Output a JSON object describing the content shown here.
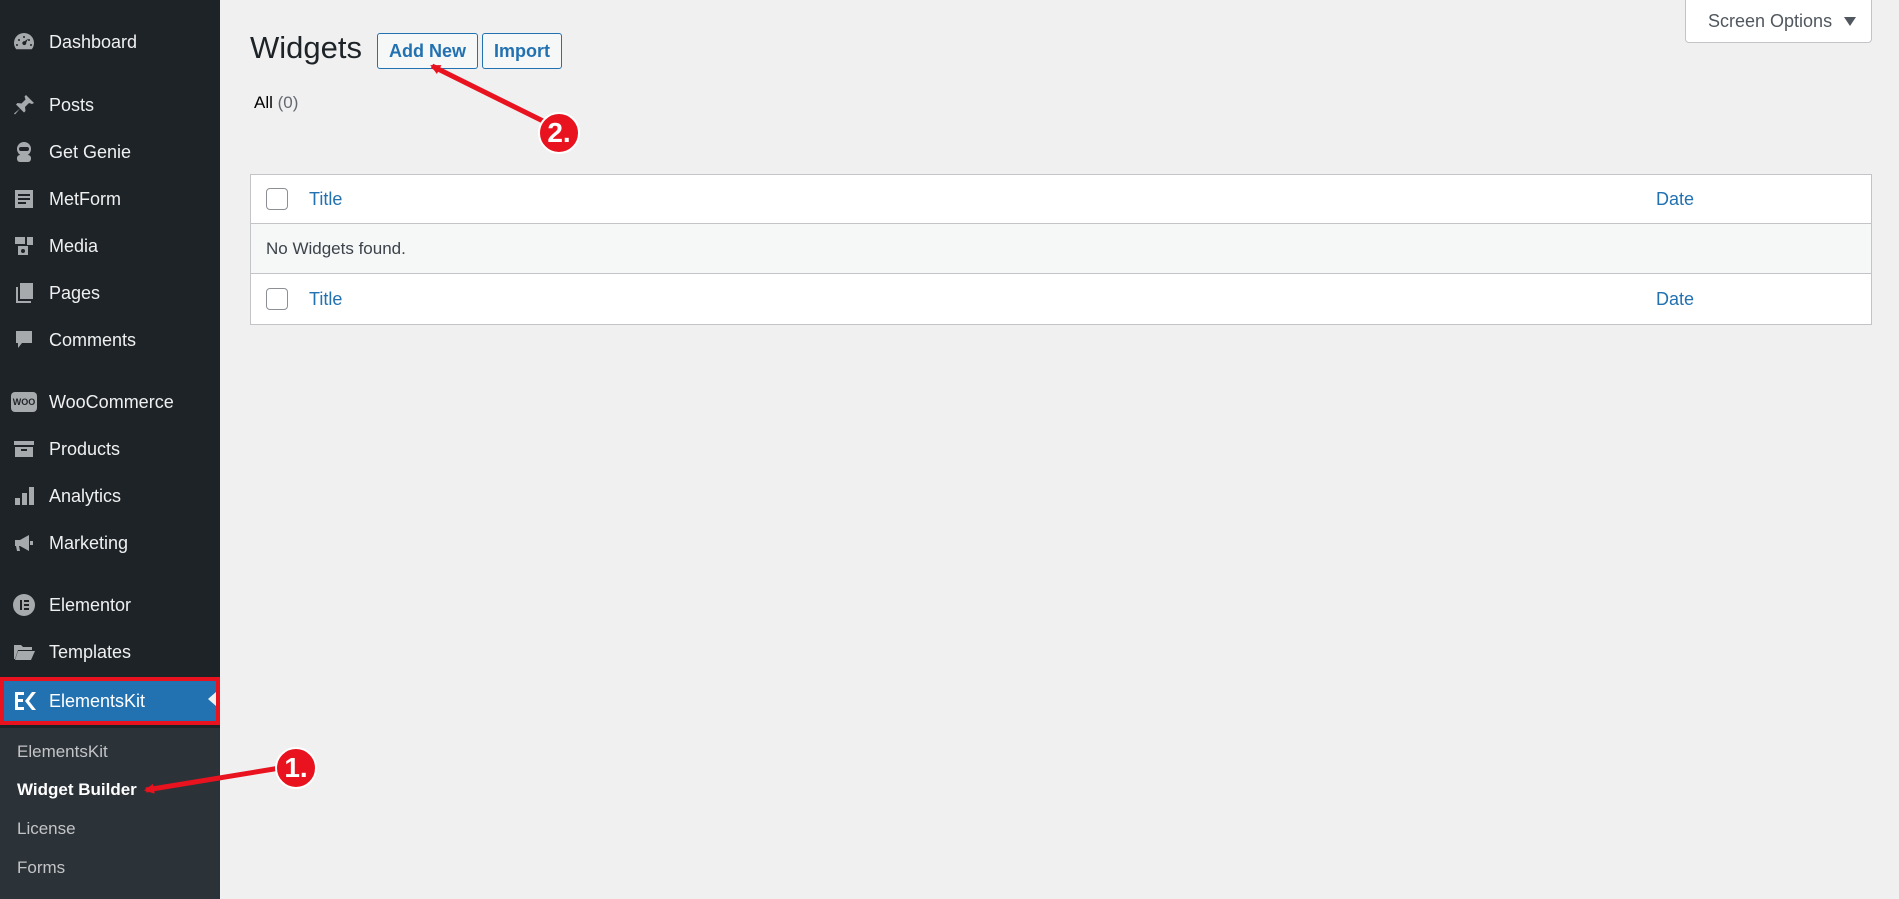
{
  "sidebar": {
    "items": [
      {
        "label": "Dashboard",
        "icon": "dashboard-icon"
      },
      {
        "label": "Posts",
        "icon": "pin-icon"
      },
      {
        "label": "Get Genie",
        "icon": "genie-icon"
      },
      {
        "label": "MetForm",
        "icon": "metform-icon"
      },
      {
        "label": "Media",
        "icon": "media-icon"
      },
      {
        "label": "Pages",
        "icon": "pages-icon"
      },
      {
        "label": "Comments",
        "icon": "comment-icon"
      },
      {
        "label": "WooCommerce",
        "icon": "woo-icon",
        "icon_text": "WOO"
      },
      {
        "label": "Products",
        "icon": "archive-icon"
      },
      {
        "label": "Analytics",
        "icon": "bar-chart-icon"
      },
      {
        "label": "Marketing",
        "icon": "megaphone-icon"
      },
      {
        "label": "Elementor",
        "icon": "elementor-icon"
      },
      {
        "label": "Templates",
        "icon": "folder-icon"
      },
      {
        "label": "ElementsKit",
        "icon": "elementskit-icon",
        "active": true
      }
    ],
    "submenu": [
      {
        "label": "ElementsKit"
      },
      {
        "label": "Widget Builder",
        "current": true
      },
      {
        "label": "License"
      },
      {
        "label": "Forms"
      }
    ]
  },
  "header": {
    "title": "Widgets",
    "add_new_label": "Add New",
    "import_label": "Import",
    "screen_options_label": "Screen Options"
  },
  "filters": {
    "all_label": "All",
    "all_count": "(0)"
  },
  "table": {
    "columns": {
      "title": "Title",
      "date": "Date"
    },
    "empty_message": "No Widgets found."
  },
  "annotations": {
    "step1": "1.",
    "step2": "2.",
    "color": "#e8131f"
  },
  "colors": {
    "sidebar_bg": "#1d2327",
    "submenu_bg": "#2c3338",
    "accent": "#2271b1",
    "highlight": "#e8131f"
  }
}
